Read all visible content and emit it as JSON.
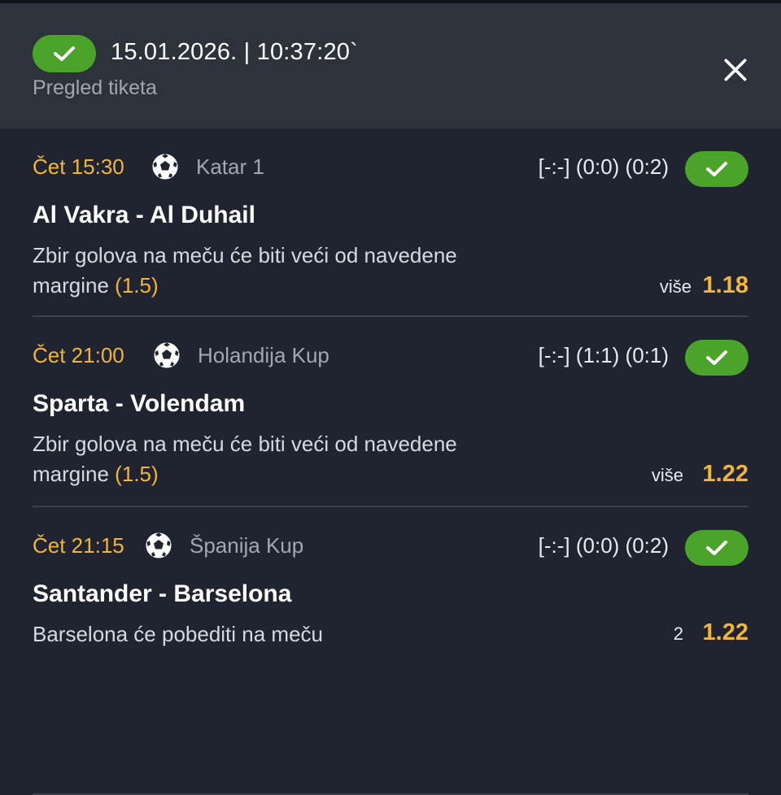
{
  "header": {
    "datetime": "15.01.2026. | 10:37:20`",
    "subtitle": "Pregled tiketa",
    "status_icon": "checkmark-icon",
    "close_icon": "close-icon"
  },
  "colors": {
    "accent": "#f2b53a",
    "win": "#4aa42a",
    "background": "#1f2430",
    "header_bg": "#2d323b"
  },
  "matches": [
    {
      "time": "Čet 15:30",
      "sport_icon": "soccer-ball-icon",
      "league": "Katar 1",
      "score": "[-:-] (0:0) (0:2)",
      "teams": "Al Vakra - Al Duhail",
      "bet_line1": "Zbir golova na meču će biti veći od navedene",
      "bet_line2": "margine",
      "margin": "(1.5)",
      "pick": "više",
      "odd": "1.18"
    },
    {
      "time": "Čet 21:00",
      "sport_icon": "soccer-ball-icon",
      "league": "Holandija Kup",
      "score": "[-:-] (1:1) (0:1)",
      "teams": "Sparta - Volendam",
      "bet_line1": "Zbir golova na meču će biti veći od navedene",
      "bet_line2": "margine",
      "margin": "(1.5)",
      "pick": "više",
      "odd": "1.22"
    },
    {
      "time": "Čet 21:15",
      "sport_icon": "soccer-ball-icon",
      "league": "Španija Kup",
      "score": "[-:-] (0:0) (0:2)",
      "teams": "Santander - Barselona",
      "bet_line1": "Barselona će pobediti na meču",
      "pick": "2",
      "odd": "1.22"
    }
  ]
}
